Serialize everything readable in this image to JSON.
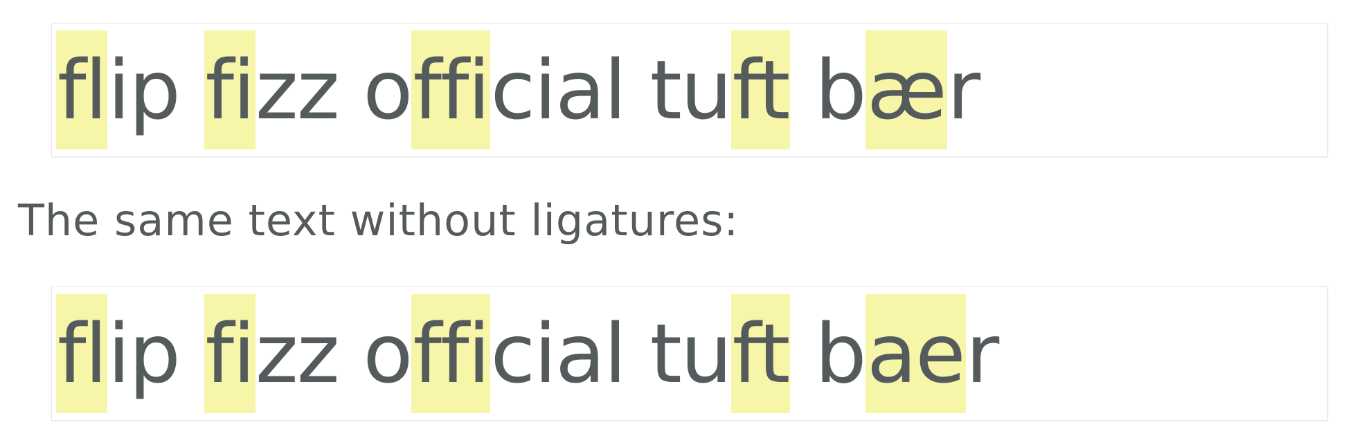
{
  "with_ligatures": {
    "segments": [
      {
        "text": "fl",
        "highlight": true
      },
      {
        "text": "ip ",
        "highlight": false
      },
      {
        "text": "fi",
        "highlight": true
      },
      {
        "text": "zz o",
        "highlight": false
      },
      {
        "text": "ffi",
        "highlight": true
      },
      {
        "text": "cial tu",
        "highlight": false
      },
      {
        "text": "ft",
        "highlight": true
      },
      {
        "text": " b",
        "highlight": false
      },
      {
        "text": "æ",
        "highlight": true
      },
      {
        "text": "r",
        "highlight": false
      }
    ]
  },
  "caption": "The same text without ligatures:",
  "without_ligatures": {
    "segments": [
      {
        "text": "fl",
        "highlight": true
      },
      {
        "text": "ip ",
        "highlight": false
      },
      {
        "text": "fi",
        "highlight": true
      },
      {
        "text": "zz o",
        "highlight": false
      },
      {
        "text": "ffi",
        "highlight": true
      },
      {
        "text": "cial tu",
        "highlight": false
      },
      {
        "text": "ft",
        "highlight": true
      },
      {
        "text": " b",
        "highlight": false
      },
      {
        "text": "ae",
        "highlight": true
      },
      {
        "text": "r",
        "highlight": false
      }
    ]
  },
  "colors": {
    "text": "#555a5c",
    "highlight": "#f6f5a8",
    "box_border": "#e6e6e6"
  }
}
